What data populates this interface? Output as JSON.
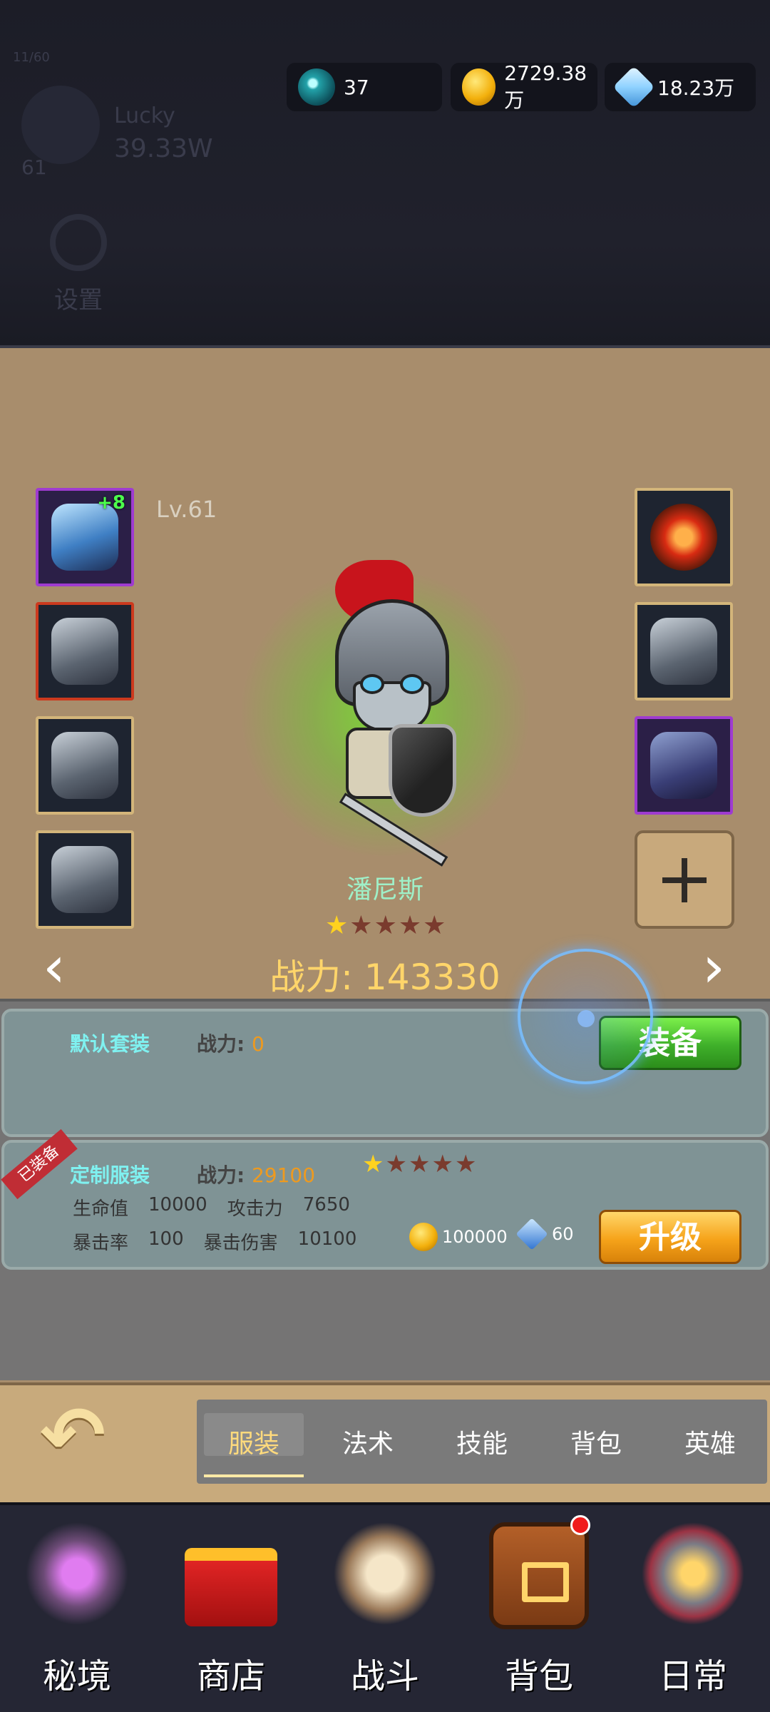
{
  "background_panel": {
    "count": "11/60",
    "player_name": "Lucky",
    "player_power": "39.33W",
    "player_level": "61",
    "settings_label": "设置"
  },
  "resources": {
    "orb": "37",
    "gold": "2729.38万",
    "diamond": "18.23万"
  },
  "hero": {
    "level": "Lv.61",
    "name": "潘尼斯",
    "stars": 1,
    "max_stars": 5,
    "power_text": "战力: 143330",
    "weapon_enhance": "+8"
  },
  "outfits": [
    {
      "title": "默认套装",
      "power_label": "战力:",
      "power_value": "0",
      "button": "装备"
    },
    {
      "title": "定制服装",
      "badge": "已装备",
      "power_label": "战力:",
      "power_value": "29100",
      "stars": 1,
      "stats_row1": [
        "生命值",
        "10000",
        "攻击力",
        "7650"
      ],
      "stats_row2": [
        "暴击率",
        "100",
        "暴击伤害",
        "10100"
      ],
      "cost_gold": "100000",
      "cost_shard": "60",
      "button": "升级"
    }
  ],
  "tabs": [
    "服装",
    "法术",
    "技能",
    "背包",
    "英雄"
  ],
  "active_tab": "服装",
  "nav": [
    "秘境",
    "商店",
    "战斗",
    "背包",
    "日常"
  ],
  "colors": {
    "gold_text": "#ffd56a",
    "name_text": "#9ff0c8",
    "equip_green": "#3fb02a",
    "upgrade_orange": "#f6a31a"
  }
}
